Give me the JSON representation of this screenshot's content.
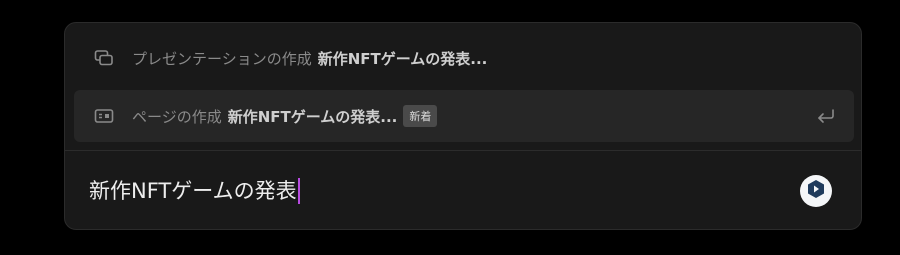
{
  "options": [
    {
      "icon": "presentation-icon",
      "prefix": "プレゼンテーションの作成",
      "query": "新作NFTゲームの発表..."
    },
    {
      "icon": "page-card-icon",
      "prefix": "ページの作成",
      "query": "新作NFTゲームの発表...",
      "badge": "新着",
      "trailing_icon": "enter-return-icon"
    }
  ],
  "input": {
    "value": "新作NFTゲームの発表"
  },
  "send_button": {
    "icon": "send-logo-icon"
  },
  "colors": {
    "background": "#000000",
    "panel": "#191919",
    "highlight": "#262626",
    "caret": "#b84be0",
    "send_button_bg": "#f4f6f8",
    "send_logo": "#1f3b5c"
  }
}
